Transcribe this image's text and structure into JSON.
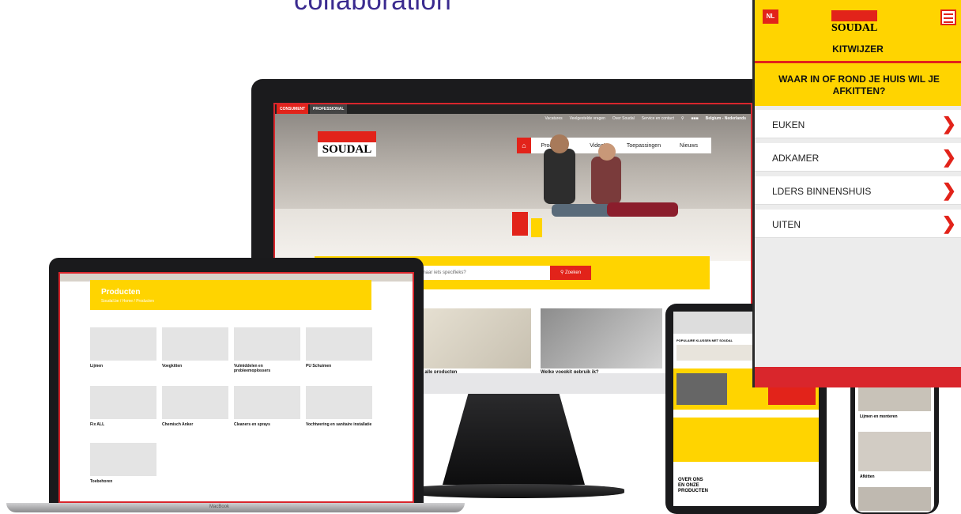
{
  "headline": "collaboration",
  "monitor": {
    "tabs": [
      "CONSUMENT",
      "PROFESSIONAL"
    ],
    "nav_links": [
      "Vacatures",
      "Veelgestelde vragen",
      "Over Soudal",
      "Service en contact"
    ],
    "country": "Belgium - Nederlands",
    "logo": "SOUDAL",
    "menu": [
      "Producten",
      "Video's",
      "Toepassingen",
      "Nieuws"
    ],
    "search_placeholder": "oek naar iets specifieks?",
    "search_button": "Zoeken",
    "cards": [
      "Bekijk alle producten",
      "Welke voegkit gebruik ik?"
    ]
  },
  "laptop": {
    "banner_title": "Producten",
    "banner_crumb": "Soudal.be / Home / Producten",
    "brand": "MacBook",
    "items": [
      {
        "label": "Lijmen"
      },
      {
        "label": "Voegkitten"
      },
      {
        "label": "Vulmiddelen en probleemoplossers"
      },
      {
        "label": "PU Schuimen"
      },
      {
        "label": "Fix ALL"
      },
      {
        "label": "Chemisch Anker"
      },
      {
        "label": "Cleaners en sprays"
      },
      {
        "label": "Vochtwering en sanitaire installatie"
      },
      {
        "label": "Toebehoren"
      }
    ]
  },
  "tablet": {
    "section_title": "POPULAIRE KLUSSEN MET SOUDAL",
    "about": [
      "OVER ONS",
      "EN ONZE",
      "PRODUCTEN"
    ]
  },
  "phone": {
    "items": [
      "Lijmen en monteren",
      "Afkitten"
    ]
  },
  "kitwijzer": {
    "lang": "NL",
    "logo": "SOUDAL",
    "title": "KITWIJZER",
    "question": "WAAR IN OF ROND JE HUIS WIL JE AFKITTEN?",
    "rows": [
      "EUKEN",
      "ADKAMER",
      "LDERS BINNENSHUIS",
      "UITEN"
    ]
  },
  "colors": {
    "brand_red": "#e2231a",
    "brand_yellow": "#ffd400"
  }
}
